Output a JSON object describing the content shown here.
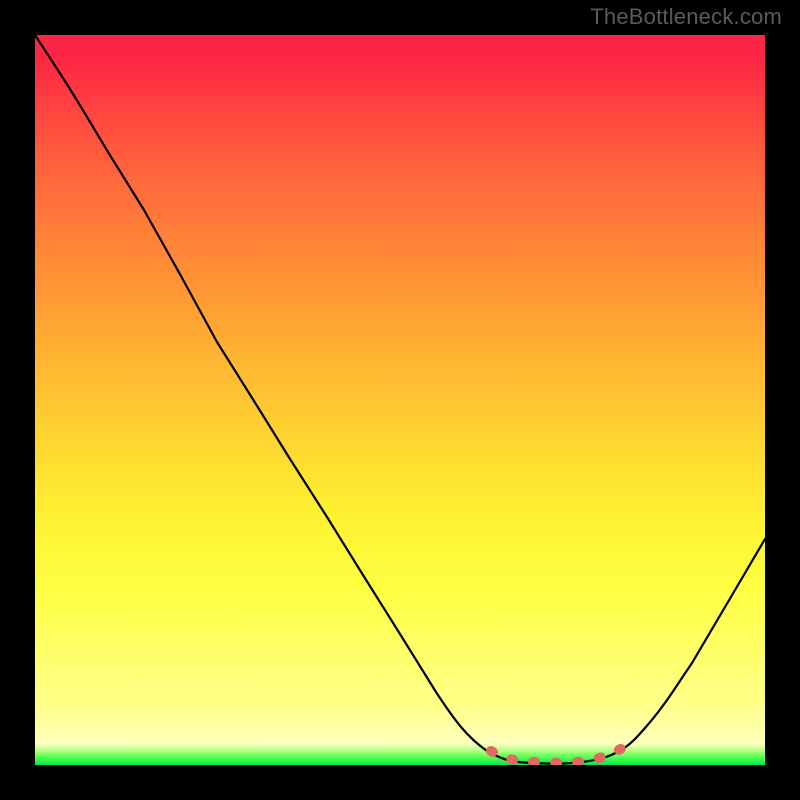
{
  "watermark": "TheBottleneck.com",
  "chart_data": {
    "type": "line",
    "title": "",
    "xlabel": "",
    "ylabel": "",
    "xlim": [
      0,
      100
    ],
    "ylim": [
      0,
      100
    ],
    "grid": false,
    "series": [
      {
        "name": "bottleneck-curve",
        "x": [
          0,
          5,
          10,
          15,
          20,
          25,
          30,
          35,
          40,
          45,
          50,
          55,
          60,
          62,
          65,
          68,
          72,
          75,
          78,
          80,
          83,
          86,
          90,
          95,
          100
        ],
        "values": [
          100,
          94,
          88,
          82,
          74,
          66,
          58,
          50,
          42,
          34,
          26,
          18,
          10,
          6,
          3,
          1,
          0.2,
          0.2,
          0.5,
          1,
          3,
          6,
          12,
          22,
          35
        ]
      }
    ],
    "highlight_zone": {
      "name": "optimal-range",
      "x_start": 62,
      "x_end": 82,
      "style": "dotted-pink"
    },
    "background_gradient": {
      "top_color": "#fe2544",
      "mid_color": "#fef231",
      "bottom_color": "#00e853",
      "meaning": "high-to-low bottleneck"
    }
  }
}
